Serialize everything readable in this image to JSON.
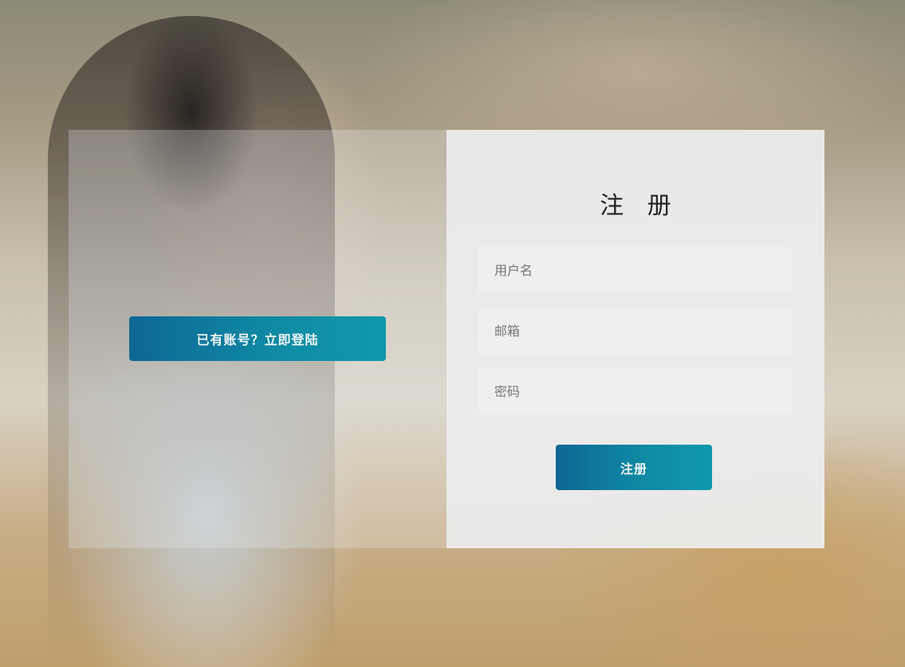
{
  "left_panel": {
    "switch_button_label": "已有账号？立即登陆"
  },
  "register_form": {
    "title": "注 册",
    "username_placeholder": "用户名",
    "email_placeholder": "邮箱",
    "password_placeholder": "密码",
    "submit_label": "注册"
  },
  "colors": {
    "button_gradient_start": "#0e6795",
    "button_gradient_end": "#1098ac",
    "form_background": "#ececec",
    "input_background": "#efeff0"
  }
}
